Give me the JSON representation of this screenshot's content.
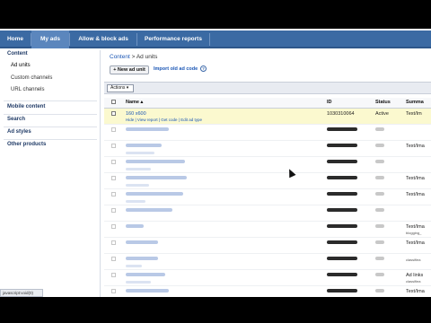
{
  "nav": {
    "tabs": [
      {
        "label": "Home",
        "selected": false
      },
      {
        "label": "My ads",
        "selected": true
      },
      {
        "label": "Allow & block ads",
        "selected": false
      },
      {
        "label": "Performance reports",
        "selected": false
      }
    ]
  },
  "sidebar": {
    "content": "Content",
    "ad_units": "Ad units",
    "custom_channels": "Custom channels",
    "url_channels": "URL channels",
    "mobile_content": "Mobile content",
    "search": "Search",
    "ad_styles": "Ad styles",
    "other_products": "Other products"
  },
  "main": {
    "breadcrumb_link": "Content",
    "breadcrumb_sep": " > ",
    "breadcrumb_current": "Ad units",
    "new_ad_unit": "+ New ad unit",
    "import_old": "Import old ad code",
    "info_icon": "?",
    "actions": "Actions ▾"
  },
  "table": {
    "headers": [
      "Name ▴",
      "ID",
      "Status",
      "Summa"
    ],
    "first_row": {
      "name": "160 x600",
      "actions": "Hide | View report | Get code | Edit ad type",
      "id": "1030310064",
      "status": "Active",
      "summary": "Text/Im"
    },
    "summaries": [
      "",
      "Text/Ima",
      "",
      "Text/Ima",
      "Text/Ima",
      "",
      "Text/Ima",
      "Text/Ima",
      "",
      "Ad links",
      "Text/Ima"
    ],
    "summary_subs": [
      "",
      "",
      "",
      "",
      "",
      "",
      "blogging_",
      "",
      "classifiea",
      "classifiea",
      ""
    ]
  },
  "statusbar": {
    "text": "javascript:void(0)"
  },
  "colors": {
    "nav_bg": "#3b6aa3",
    "nav_selected": "#5b86bd",
    "link": "#1a56b5",
    "highlight_row": "#fbf9cf"
  }
}
